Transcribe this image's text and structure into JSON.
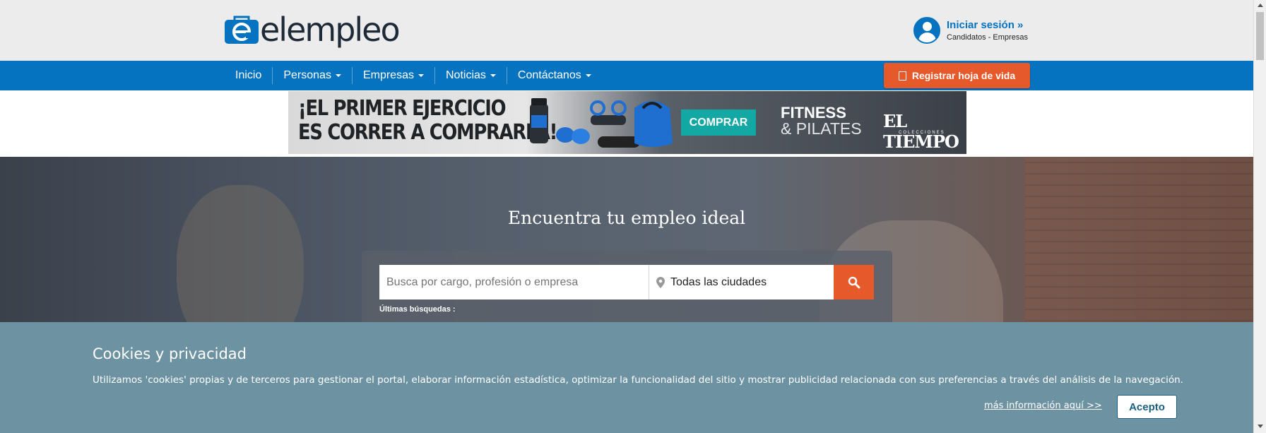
{
  "header": {
    "logo_text": "elempleo",
    "login_label": "Iniciar sesión »",
    "login_sub": "Candidatos - Empresas"
  },
  "nav": {
    "items": [
      {
        "label": "Inicio",
        "has_dropdown": false
      },
      {
        "label": "Personas",
        "has_dropdown": true
      },
      {
        "label": "Empresas",
        "has_dropdown": true
      },
      {
        "label": "Noticias",
        "has_dropdown": true
      },
      {
        "label": "Contáctanos",
        "has_dropdown": true
      }
    ],
    "register_label": "Registrar hoja de vida"
  },
  "ad": {
    "headline_line1": "¡EL PRIMER EJERCICIO",
    "headline_line2": "ES CORRER A COMPRARLA!",
    "buy_label": "COMPRAR",
    "fitness_line1": "FITNESS",
    "fitness_line2": "& PILATES",
    "brand": "EL TIEMPO",
    "brand_sub": "COLECCIONES"
  },
  "hero": {
    "title": "Encuentra tu empleo ideal",
    "search_placeholder": "Busca por cargo, profesión o empresa",
    "city_value": "Todas las ciudades",
    "recent_label": "Últimas búsquedas :"
  },
  "cookie": {
    "title": "Cookies y privacidad",
    "text": "Utilizamos 'cookies' propias y de terceros para gestionar el portal, elaborar información estadística, optimizar la funcionalidad del sitio y mostrar publicidad relacionada con sus preferencias a través del análisis de la navegación.",
    "more_label": "más información aquí >>",
    "accept_label": "Acepto"
  },
  "colors": {
    "brand_blue": "#0673c1",
    "accent_orange": "#e5592b",
    "cookie_bg": "#6d93a3"
  },
  "icons": [
    "logo-briefcase-icon",
    "user-avatar-icon",
    "chevron-down-icon",
    "document-icon",
    "map-pin-icon",
    "search-icon"
  ]
}
